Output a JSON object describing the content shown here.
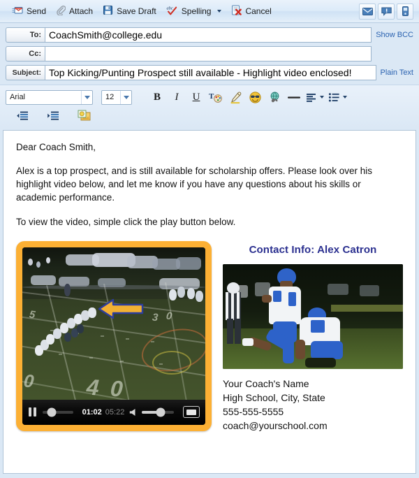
{
  "toolbar": {
    "buttons": [
      {
        "label": "Send",
        "icon": "send-envelope-icon"
      },
      {
        "label": "Attach",
        "icon": "paperclip-icon"
      },
      {
        "label": "Save Draft",
        "icon": "save-disk-icon"
      },
      {
        "label": "Spelling",
        "icon": "spellcheck-abc-icon",
        "has_dropdown": true
      },
      {
        "label": "Cancel",
        "icon": "cancel-document-x-icon"
      }
    ],
    "right_icons": [
      {
        "name": "mail-priority-icon"
      },
      {
        "name": "request-receipt-icon"
      },
      {
        "name": "mobile-notify-icon"
      }
    ]
  },
  "fields": {
    "to": {
      "label": "To:",
      "value": "CoachSmith@college.edu",
      "placeholder": ""
    },
    "cc": {
      "label": "Cc:",
      "value": "",
      "placeholder": ""
    },
    "subject": {
      "label": "Subject:",
      "value": "Top Kicking/Punting Prospect still available - Highlight video enclosed!",
      "placeholder": ""
    },
    "show_bcc_link": "Show BCC",
    "plain_text_link": "Plain Text"
  },
  "format_toolbar": {
    "font_family": "Arial",
    "font_size": "12",
    "row1": [
      {
        "glyph": "B",
        "name": "bold-button"
      },
      {
        "glyph": "I",
        "name": "italic-button"
      },
      {
        "glyph": "U",
        "name": "underline-button"
      },
      {
        "glyph": "T",
        "name": "font-color-button"
      },
      {
        "glyph": "",
        "name": "highlight-button"
      },
      {
        "glyph": "",
        "name": "emoticon-button"
      },
      {
        "glyph": "",
        "name": "insert-link-button"
      },
      {
        "glyph": "",
        "name": "horizontal-rule-button"
      },
      {
        "glyph": "",
        "name": "align-button"
      },
      {
        "glyph": "",
        "name": "list-button"
      }
    ],
    "row2": [
      {
        "name": "outdent-button"
      },
      {
        "name": "indent-button"
      },
      {
        "name": "insert-image-button"
      }
    ]
  },
  "message": {
    "greeting": "Dear Coach Smith,",
    "paragraph1": "Alex is a top prospect, and is still available for scholarship offers. Please look over his highlight video below, and let me know if you have any questions about his skills or academic performance.",
    "paragraph2": "To view the video, simple click the play button below."
  },
  "video": {
    "current_time": "01:02",
    "duration": "05:22",
    "state": "playing",
    "frame_color": "#fcb034"
  },
  "contact": {
    "title": "Contact Info: Alex Catron",
    "title_color": "#2a2f8f",
    "name": "Your Coach's Name",
    "school": "High School, City, State",
    "phone": "555-555-5555",
    "email": "coach@yourschool.com"
  }
}
